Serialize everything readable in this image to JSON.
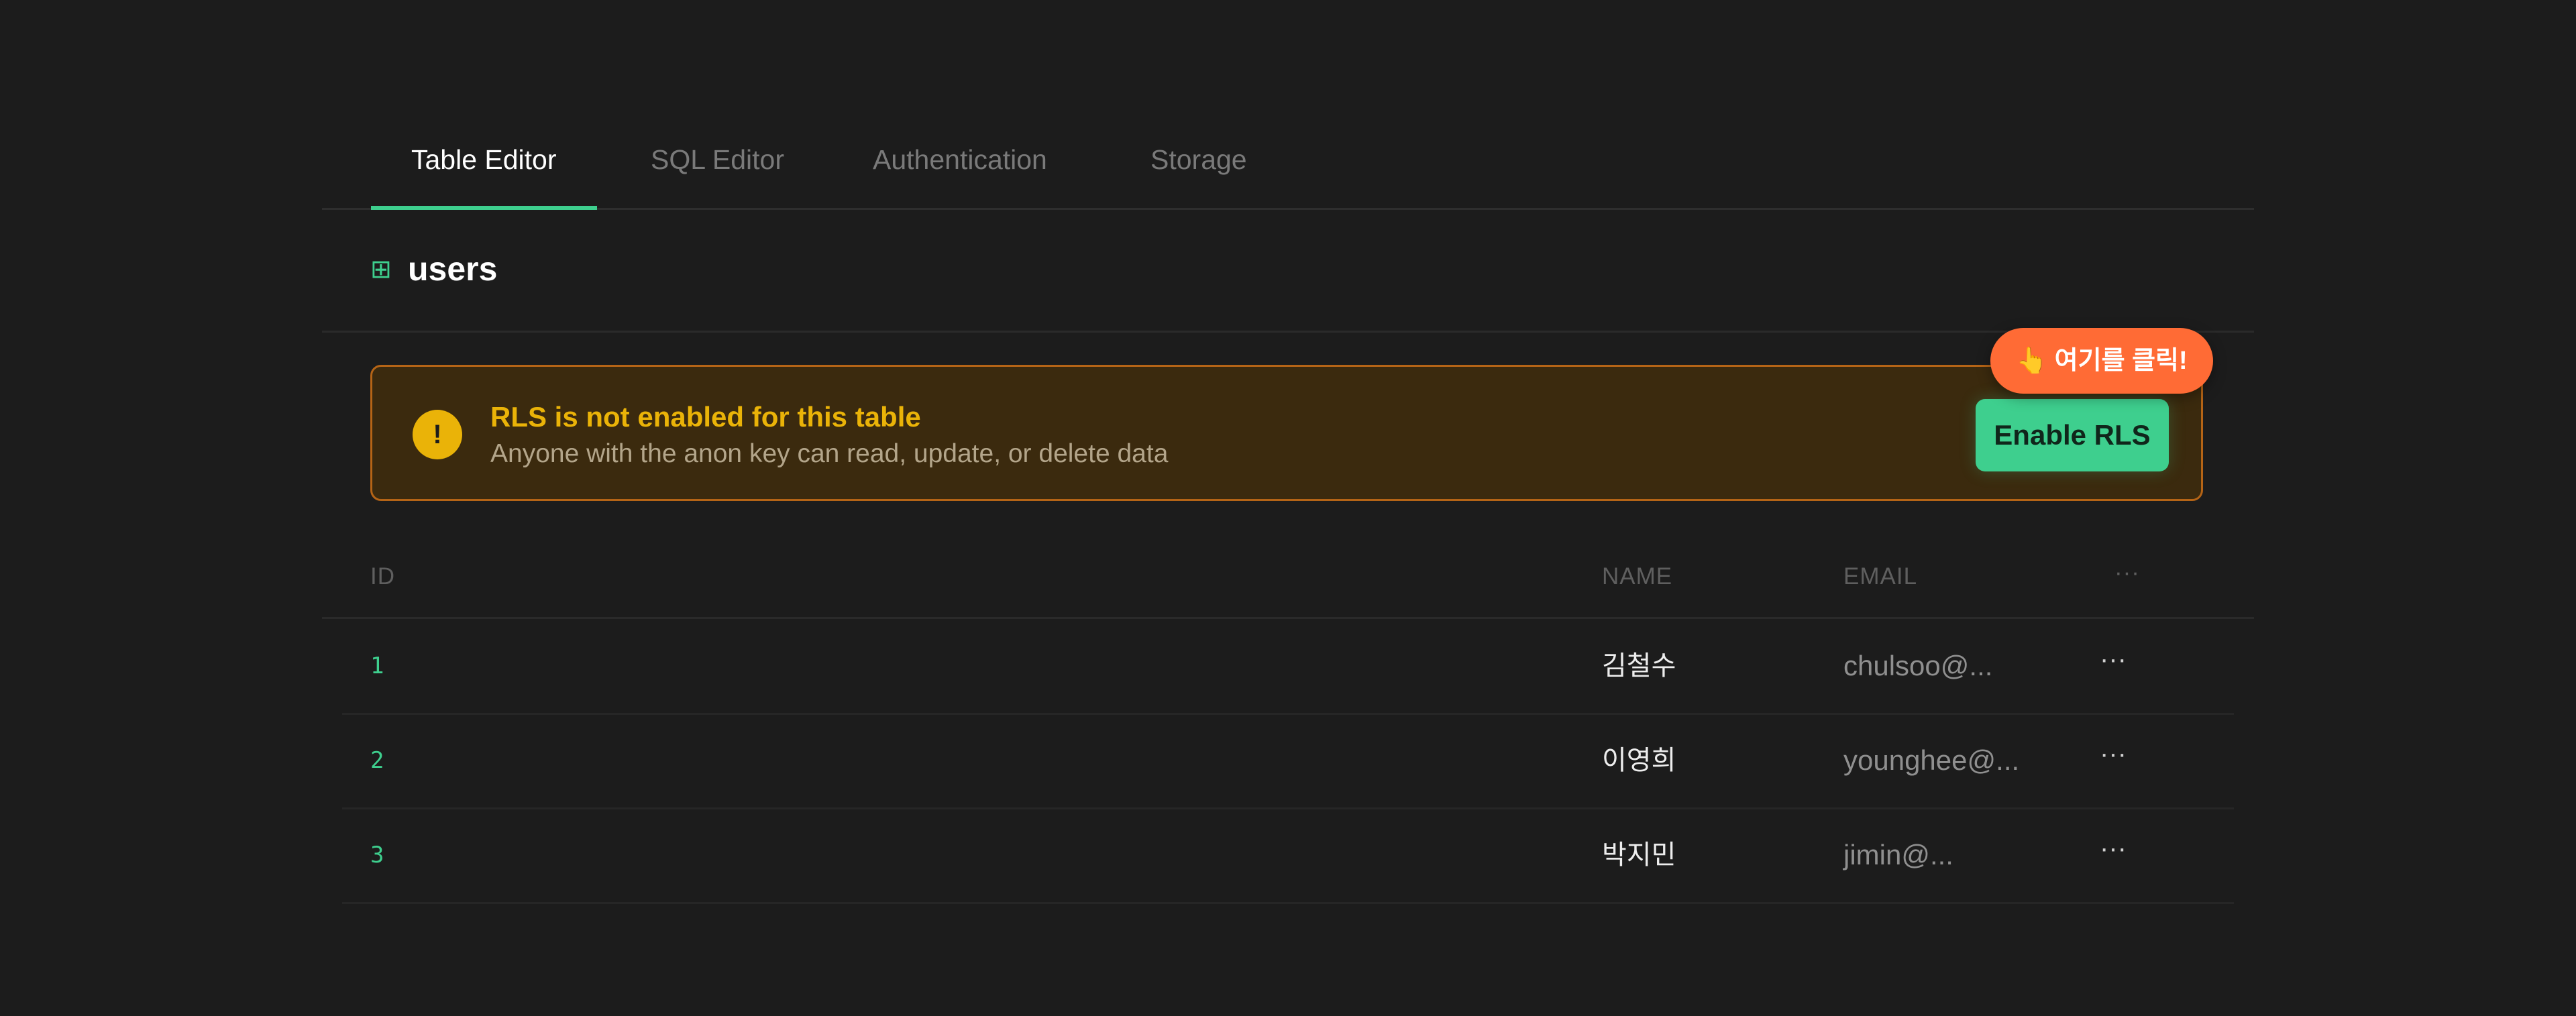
{
  "tabs": [
    {
      "label": "Table Editor",
      "active": true
    },
    {
      "label": "SQL Editor",
      "active": false
    },
    {
      "label": "Authentication",
      "active": false
    },
    {
      "label": "Storage",
      "active": false
    }
  ],
  "table": {
    "icon": "table-grid-icon",
    "icon_glyph": "⊞",
    "name": "users"
  },
  "banner": {
    "icon": "exclamation-icon",
    "icon_glyph": "!",
    "title": "RLS is not enabled for this table",
    "subtitle": "Anyone with the anon key can read, update, or delete data",
    "button_label": "Enable RLS",
    "callout_hand": "👆",
    "callout_text": "여기를 클릭!"
  },
  "grid": {
    "columns": [
      "ID",
      "NAME",
      "EMAIL",
      "···"
    ],
    "rows": [
      {
        "id": "1",
        "name": "김철수",
        "email": "chulsoo@...",
        "more": "···"
      },
      {
        "id": "2",
        "name": "이영희",
        "email": "younghee@...",
        "more": "···"
      },
      {
        "id": "3",
        "name": "박지민",
        "email": "jimin@...",
        "more": "···"
      }
    ]
  },
  "colors": {
    "background": "#1c1c1c",
    "accent": "#3ecf8e",
    "warning": "#eab308",
    "callout": "#ff6b35"
  }
}
